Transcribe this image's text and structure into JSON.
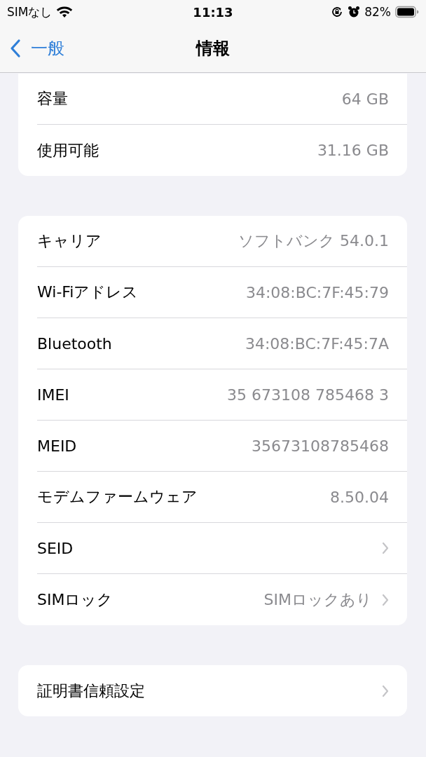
{
  "status_bar": {
    "carrier": "SIMなし",
    "time": "11:13",
    "battery": "82%"
  },
  "nav": {
    "back": "一般",
    "title": "情報"
  },
  "groups": [
    {
      "rows": [
        {
          "label": "容量",
          "value": "64 GB"
        },
        {
          "label": "使用可能",
          "value": "31.16 GB"
        }
      ]
    },
    {
      "rows": [
        {
          "label": "キャリア",
          "value": "ソフトバンク 54.0.1"
        },
        {
          "label": "Wi-Fiアドレス",
          "value": "34:08:BC:7F:45:79"
        },
        {
          "label": "Bluetooth",
          "value": "34:08:BC:7F:45:7A"
        },
        {
          "label": "IMEI",
          "value": "35 673108 785468 3"
        },
        {
          "label": "MEID",
          "value": "35673108785468"
        },
        {
          "label": "モデムファームウェア",
          "value": "8.50.04"
        },
        {
          "label": "SEID",
          "chevron": true
        },
        {
          "label": "SIMロック",
          "value": "SIMロックあり",
          "chevron": true
        }
      ]
    },
    {
      "rows": [
        {
          "label": "証明書信頼設定",
          "chevron": true
        }
      ]
    }
  ]
}
